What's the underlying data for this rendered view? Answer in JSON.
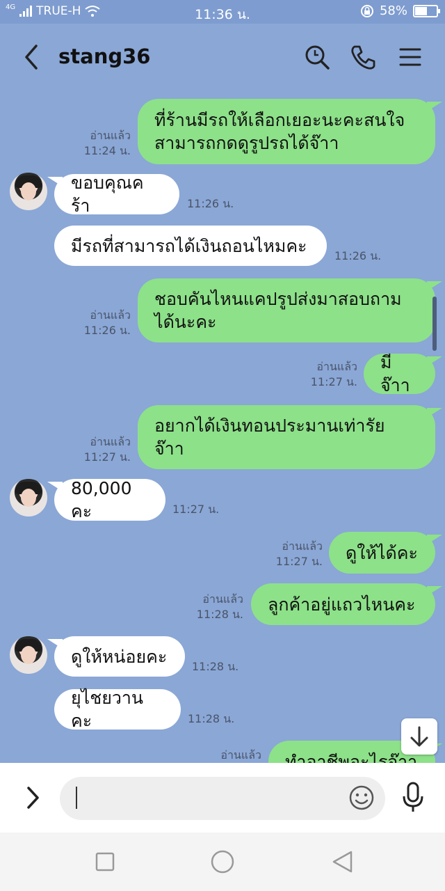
{
  "status_bar": {
    "network_type": "4G",
    "carrier": "TRUE-H",
    "time": "11:36 น.",
    "battery_percent": "58%",
    "battery_level": 0.58,
    "icons": [
      "signal-icon",
      "wifi-icon",
      "rotation-lock-icon",
      "battery-icon"
    ]
  },
  "header": {
    "contact_name": "stang36",
    "icons": [
      "back-arrow-icon",
      "search-icon",
      "phone-icon",
      "menu-icon"
    ]
  },
  "messages": [
    {
      "side": "out",
      "lines": [
        "ที่ร้านมีรถให้เลือกเยอะนะคะสนใจ",
        "สามารถกดดูรูปรถได้จ๊าา"
      ],
      "status": "อ่านแล้ว",
      "time": "11:24 น."
    },
    {
      "side": "in",
      "lines": [
        "ขอบคุณคร้า"
      ],
      "time": "11:26 น.",
      "avatar": true
    },
    {
      "side": "in",
      "lines": [
        "มีรถที่สามารถได้เงินถอนไหมคะ"
      ],
      "time": "11:26 น."
    },
    {
      "side": "out",
      "lines": [
        "ชอบคันไหนแคปรูปส่งมาสอบถาม",
        "ได้นะคะ"
      ],
      "status": "อ่านแล้ว",
      "time": "11:26 น."
    },
    {
      "side": "out",
      "lines": [
        "มีจ๊าา"
      ],
      "status": "อ่านแล้ว",
      "time": "11:27 น."
    },
    {
      "side": "out",
      "lines": [
        "อยากได้เงินทอนประมานเท่ารัย",
        "จ๊าา"
      ],
      "status": "อ่านแล้ว",
      "time": "11:27 น."
    },
    {
      "side": "in",
      "lines": [
        "80,000 คะ"
      ],
      "time": "11:27 น.",
      "avatar": true
    },
    {
      "side": "out",
      "lines": [
        "ดูให้ได้คะ"
      ],
      "status": "อ่านแล้ว",
      "time": "11:27 น."
    },
    {
      "side": "out",
      "lines": [
        "ลูกค้าอยู่แถวไหนคะ"
      ],
      "status": "อ่านแล้ว",
      "time": "11:28 น."
    },
    {
      "side": "in",
      "lines": [
        "ดูให้หน่อยคะ"
      ],
      "time": "11:28 น.",
      "avatar": true
    },
    {
      "side": "in",
      "lines": [
        "ยุไชยวานคะ"
      ],
      "time": "11:28 น."
    },
    {
      "side": "out",
      "lines": [
        "ทำอาชีพอะไรจ๊าา"
      ],
      "status": "อ่านแล้ว",
      "time": ""
    }
  ],
  "input_bar": {
    "value": "",
    "icons": [
      "expand-arrow-icon",
      "emoji-icon",
      "microphone-icon"
    ]
  },
  "nav_bar": {
    "icons": [
      "recent-apps-icon",
      "home-icon",
      "back-triangle-icon"
    ]
  },
  "colors": {
    "chat_background": "#8aa7d6",
    "outgoing_bubble": "#8de189",
    "incoming_bubble": "#ffffff"
  }
}
